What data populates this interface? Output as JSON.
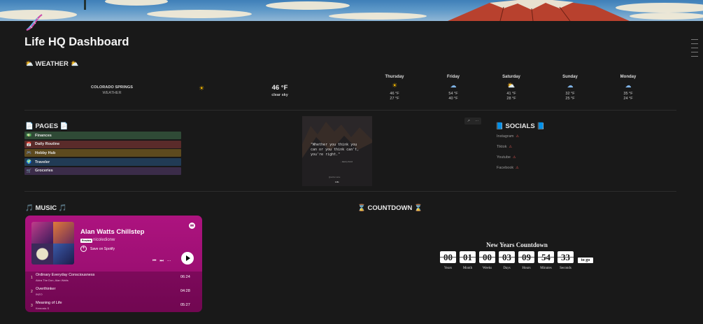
{
  "page": {
    "title": "Life HQ Dashboard"
  },
  "weather": {
    "heading": "WEATHER",
    "heading_emoji": "⛅",
    "location": "COLORADO SPRINGS",
    "location_sub": "WEATHER",
    "current_icon": "sun-icon",
    "current_temp": "46 °F",
    "current_condition": "clear sky",
    "forecast": [
      {
        "day": "Thursday",
        "icon": "sun-icon",
        "high": "46 °F",
        "low": "27 °F"
      },
      {
        "day": "Friday",
        "icon": "cloud-icon",
        "high": "54 °F",
        "low": "40 °F"
      },
      {
        "day": "Saturday",
        "icon": "partly-cloudy-icon",
        "high": "41 °F",
        "low": "28 °F"
      },
      {
        "day": "Sunday",
        "icon": "cloud-icon",
        "high": "32 °F",
        "low": "25 °F"
      },
      {
        "day": "Monday",
        "icon": "cloud-icon",
        "high": "35 °F",
        "low": "24 °F"
      }
    ]
  },
  "pages": {
    "heading": "PAGES",
    "heading_emoji": "📄",
    "items": [
      {
        "label": "Finances",
        "icon": "💵",
        "color": "#2f4a36"
      },
      {
        "label": "Daily Routine",
        "icon": "📅",
        "color": "#5a2b2a"
      },
      {
        "label": "Hobby Hub",
        "icon": "🎮",
        "color": "#5d4a1e"
      },
      {
        "label": "Traveler",
        "icon": "🌍",
        "color": "#213b55"
      },
      {
        "label": "Groceries",
        "icon": "🛒",
        "color": "#3b2c49"
      }
    ]
  },
  "quote": {
    "text": "\"Whether you think you can or you think can't, you're right.\"",
    "author": "- Henry Ford",
    "footer": "@author.name",
    "logo": "Lifo"
  },
  "mini_controls": {
    "expand": "↗",
    "more": "···"
  },
  "socials": {
    "heading": "SOCIALS",
    "heading_emoji": "📘",
    "items": [
      "Instagram",
      "Tiktok",
      "Youtube",
      "Facebook"
    ],
    "warn_icon": "⚠"
  },
  "music": {
    "heading": "MUSIC",
    "heading_emoji": "🎵",
    "playlist_title": "Alan Watts Chillstep",
    "badge": "Preview",
    "user": "nicoledionw",
    "save_label": "Save on Spotify",
    "prev_icon": "⏮",
    "next_icon": "⏭",
    "more_icon": "···",
    "tracks": [
      {
        "num": "1",
        "name": "Ordinary Everyday Consciousness",
        "artist": "Akira The Don, Alan Watts",
        "duration": "06:24"
      },
      {
        "num": "2",
        "name": "Overthinker",
        "artist": "INZO",
        "duration": "04:28"
      },
      {
        "num": "3",
        "name": "Meaning of Life",
        "artist": "Kemosis S",
        "duration": "05:27"
      }
    ]
  },
  "countdown": {
    "heading": "COUNTDOWN",
    "heading_emoji": "⌛",
    "title": "New Years Countdown",
    "units": [
      {
        "value": "00",
        "label": "Years"
      },
      {
        "value": "01",
        "label": "Month"
      },
      {
        "value": "00",
        "label": "Weeks"
      },
      {
        "value": "03",
        "label": "Days"
      },
      {
        "value": "09",
        "label": "Hours"
      },
      {
        "value": "54",
        "label": "Minutes"
      },
      {
        "value": "33",
        "label": "Seconds"
      }
    ],
    "to_go": "to go"
  }
}
